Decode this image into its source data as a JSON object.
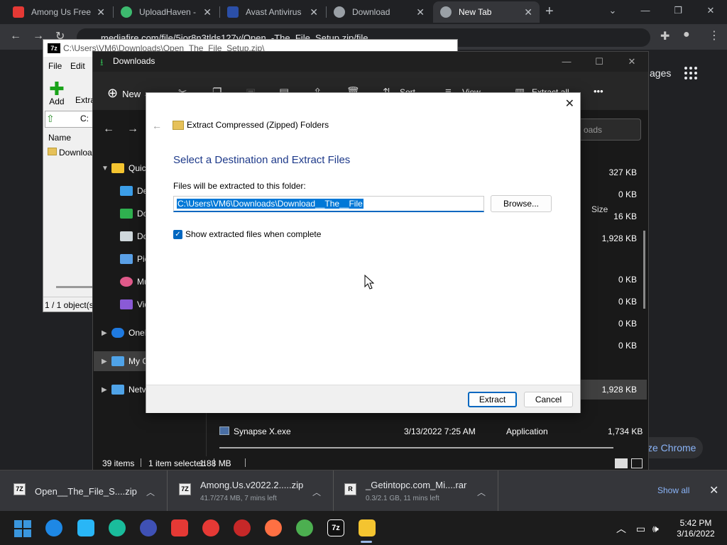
{
  "chrome": {
    "tabs": [
      {
        "title": "Among Us Free",
        "color": "#e53935"
      },
      {
        "title": "UploadHaven -",
        "color": "#3dba6f"
      },
      {
        "title": "Avast Antivirus",
        "color": "#2b4fa8"
      },
      {
        "title": "Download",
        "color": "#9aa0a6"
      },
      {
        "title": "New Tab",
        "color": "#9aa0a6"
      }
    ],
    "close_glyph": "✕",
    "new_tab_glyph": "+",
    "url": "mediafire.com/file/5jor8n3tlds127y/Open_-The_File_Setup.zip/file",
    "pages_link": "ages",
    "customize": "ze Chrome"
  },
  "sevenzip": {
    "title": "C:\\Users\\VM6\\Downloads\\Open_The_File_Setup.zip\\",
    "logo": "7z",
    "menu": [
      "File",
      "Edit"
    ],
    "add_label": "Add",
    "extract_label": "Extra",
    "path_short": "C:",
    "name_header": "Name",
    "row_name": "Downloa",
    "status": "1 / 1 object(s"
  },
  "explorer": {
    "title": "Downloads",
    "new_label": "New",
    "sort_label": "Sort",
    "view_label": "View",
    "extract_all_label": "Extract all",
    "more": "•••",
    "search_placeholder": "oads",
    "size_header": "Size",
    "sizes": [
      "327 KB",
      "0 KB",
      "16 KB",
      "1,928 KB",
      "0 KB",
      "0 KB",
      "0 KB",
      "0 KB",
      "1,928 KB"
    ],
    "nav": [
      {
        "label": "Quic",
        "color": "#f4c430"
      },
      {
        "label": "Des",
        "color": "#3c9ee8"
      },
      {
        "label": "Dov",
        "color": "#2fb04f"
      },
      {
        "label": "Doc",
        "color": "#cfd8dc"
      },
      {
        "label": "Pict",
        "color": "#5aa0e6"
      },
      {
        "label": "Mu",
        "color": "#e05a8a"
      },
      {
        "label": "Vid",
        "color": "#8a5ad6"
      },
      {
        "label": "OneI",
        "color": "#1f7ae0"
      },
      {
        "label": "My C",
        "color": "#4fa3e8"
      },
      {
        "label": "Netv",
        "color": "#4fa3e8"
      }
    ],
    "synapse": {
      "name": "Synapse X.exe",
      "date": "3/13/2022 7:25 AM",
      "type": "Application",
      "size": "1,734 KB"
    },
    "status": {
      "items": "39 items",
      "selected": "1 item selected",
      "size": "1.88 MB"
    }
  },
  "dialog": {
    "window_title": "Extract Compressed (Zipped) Folders",
    "heading": "Select a Destination and Extract Files",
    "label": "Files will be extracted to this folder:",
    "path": "C:\\Users\\VM6\\Downloads\\Download__The__File",
    "browse": "Browse...",
    "checkbox_label": "Show extracted files when complete",
    "checkbox_glyph": "✓",
    "extract": "Extract",
    "cancel": "Cancel",
    "close_glyph": "✕",
    "back_glyph": "←"
  },
  "downloads": {
    "items": [
      {
        "name": "Open__The_File_S....zip",
        "sub": ""
      },
      {
        "name": "Among.Us.v2022.2.....zip",
        "sub": "41.7/274 MB, 7 mins left"
      },
      {
        "name": "_Getintopc.com_Mi....rar",
        "sub": "0.3/2.1 GB, 11 mins left"
      }
    ],
    "show_all": "Show all",
    "close_glyph": "✕"
  },
  "taskbar": {
    "time": "5:42 PM",
    "date": "3/16/2022",
    "apps": [
      {
        "name": "firefox-icon",
        "color": "#1e88e5"
      },
      {
        "name": "wing-icon",
        "color": "#29b6f6"
      },
      {
        "name": "edge-icon",
        "color": "#1abc9c"
      },
      {
        "name": "firefox-dev-icon",
        "color": "#3f51b5"
      },
      {
        "name": "vivaldi-icon",
        "color": "#e53935"
      },
      {
        "name": "opera-icon",
        "color": "#e53935"
      },
      {
        "name": "opera-gx-icon",
        "color": "#c62828"
      },
      {
        "name": "firefox-alt-icon",
        "color": "#ff7043"
      },
      {
        "name": "chrome-icon",
        "color": "#4caf50"
      },
      {
        "name": "sevenzip-taskbar-icon",
        "color": "#111111"
      },
      {
        "name": "file-explorer-icon",
        "color": "#f4c430"
      }
    ]
  }
}
